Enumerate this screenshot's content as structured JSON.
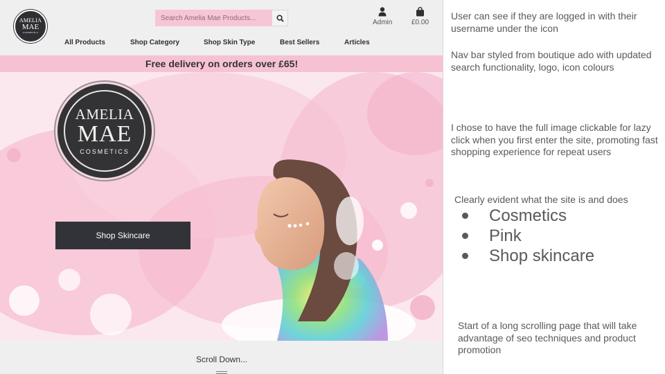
{
  "site": {
    "logo_small": {
      "line1": "AMELIA",
      "line2": "MAE",
      "line3": "COSMETICS"
    },
    "search": {
      "placeholder": "Search Amelia Mae Products..."
    },
    "account": {
      "label": "Admin",
      "icon": "user-icon"
    },
    "basket": {
      "label": "£0.00",
      "icon": "shopping-bag-icon"
    },
    "nav": [
      "All Products",
      "Shop Category",
      "Shop Skin Type",
      "Best Sellers",
      "Articles"
    ],
    "banner": "Free delivery on orders over £65!",
    "hero": {
      "logo": {
        "line1": "AMELIA",
        "line2": "MAE",
        "line3": "COSMETICS"
      },
      "cta": "Shop Skincare"
    },
    "scroll_label": "Scroll Down..."
  },
  "notes": {
    "note1": "User can see if they are logged in with their username under the icon",
    "note2": "Nav bar styled from boutique ado with updated search functionality, logo, icon colours",
    "note3": "I chose to have the full image clickable for lazy click when you first enter the site, promoting fast shopping experience for repeat users",
    "note4": "Clearly evident what the site is and does",
    "bullets": [
      "Cosmetics",
      "Pink",
      "Shop skincare"
    ],
    "note5": "Start of a long scrolling page that will take advantage of seo techniques and product promotion"
  },
  "colors": {
    "banner": "#f6c2d2",
    "search_bg": "#f7c6d6",
    "button_dark": "#323338",
    "header_bg": "#efefef",
    "note_text": "#595959"
  }
}
